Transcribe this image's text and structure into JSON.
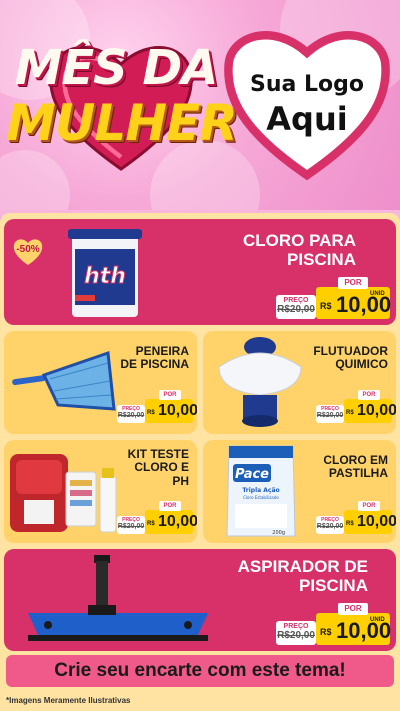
{
  "header": {
    "title_line1": "MÊS DA",
    "title_line2": "MULHER",
    "logo_line1": "Sua Logo",
    "logo_line2": "Aqui"
  },
  "products": [
    {
      "name_line1": "CLORO PARA",
      "name_line2": "PISCINA",
      "badge": "-50%",
      "price_label": "PREÇO",
      "old_price": "R$20,00",
      "por_label": "POR",
      "currency": "R$",
      "new_price": "10,00",
      "unit": "UNID"
    },
    {
      "name_line1": "PENEIRA",
      "name_line2": "DE PISCINA",
      "price_label": "PREÇO",
      "old_price": "R$20,00",
      "por_label": "POR",
      "currency": "R$",
      "new_price": "10,00"
    },
    {
      "name_line1": "FLUTUADOR",
      "name_line2": "QUIMICO",
      "price_label": "PREÇO",
      "old_price": "R$20,00",
      "por_label": "POR",
      "currency": "R$",
      "new_price": "10,00"
    },
    {
      "name_line1": "KIT TESTE",
      "name_line2": "CLORO E",
      "name_line3": "PH",
      "price_label": "PREÇO",
      "old_price": "R$20,00",
      "por_label": "POR",
      "currency": "R$",
      "new_price": "10,00"
    },
    {
      "name_line1": "CLORO EM",
      "name_line2": "PASTILHA",
      "price_label": "PREÇO",
      "old_price": "R$20,00",
      "por_label": "POR",
      "currency": "R$",
      "new_price": "10,00"
    },
    {
      "name_line1": "ASPIRADOR DE",
      "name_line2": "PISCINA",
      "price_label": "PREÇO",
      "old_price": "R$20,00",
      "por_label": "POR",
      "currency": "R$",
      "new_price": "10,00",
      "unit": "UNID"
    }
  ],
  "images": {
    "hth_brand": "hth",
    "pace_brand": "Pace",
    "pace_sub1": "Tripla Ação",
    "pace_sub2": "Cloro Estabilizado",
    "pace_weight": "200g"
  },
  "cta": "Crie seu encarte com este tema!",
  "footer_note": "*Imagens Meramente Ilustrativas",
  "colors": {
    "red_card": "#d8316a",
    "yellow_card": "#ffd36a",
    "background": "#ffe3a3",
    "price_yellow": "#ffcf00",
    "title_gold": "#ffd21a"
  }
}
